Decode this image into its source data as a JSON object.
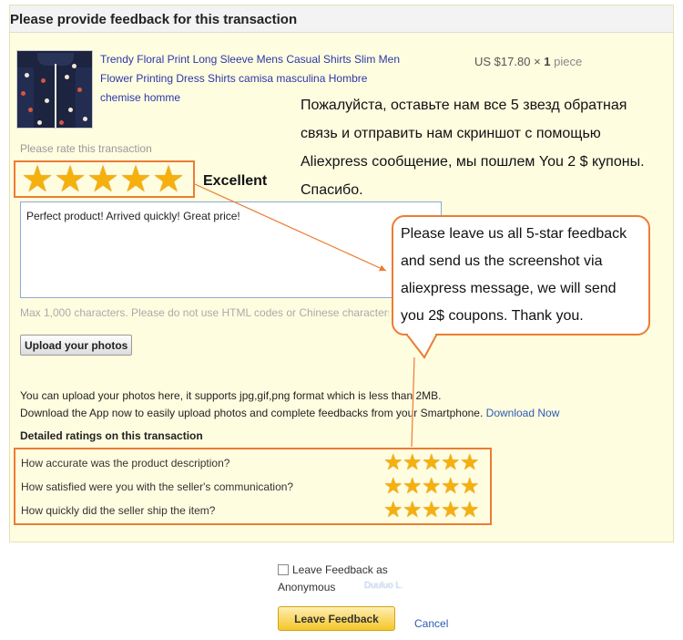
{
  "header": {
    "title": "Please provide feedback for this transaction"
  },
  "product": {
    "title": "Trendy Floral Print Long Sleeve Mens Casual Shirts Slim Men Flower Printing Dress Shirts camisa masculina Hombre chemise homme",
    "price": "US $17.80",
    "times": "×",
    "quantity": "1",
    "unit": "piece"
  },
  "overlay": {
    "russian": "Пожалуйста, оставьте нам все 5 звезд обратная связь и отправить нам скриншот с помощью Aliexpress сообщение, мы пошлем You 2 $ купоны. Спасибо.",
    "callout": "Please leave us all 5-star feedback and send us the screenshot via aliexpress message, we will send you 2$ coupons. Thank you."
  },
  "rating": {
    "label": "Please rate this transaction",
    "stars": 5,
    "max": 5,
    "star_glyph": "★",
    "text": "Excellent",
    "star_color": "#f5b00d"
  },
  "comment": {
    "value": "Perfect product! Arrived quickly! Great price!",
    "hint": "Max 1,000 characters. Please do not use HTML codes or Chinese characters."
  },
  "upload": {
    "button": "Upload your photos",
    "info": "You can upload your photos here, it supports jpg,gif,png format which is less than 2MB.",
    "app_info": "Download the App now to easily upload photos and complete feedbacks from your Smartphone.",
    "download_link": "Download Now"
  },
  "detailed": {
    "title": "Detailed ratings on this transaction",
    "items": [
      {
        "question": "How accurate was the product description?",
        "stars": 5
      },
      {
        "question": "How satisfied were you with the seller's communication?",
        "stars": 5
      },
      {
        "question": "How quickly did the seller ship the item?",
        "stars": 5
      }
    ]
  },
  "footer": {
    "anonymous_label": "Leave Feedback as",
    "anonymous_label2": "Anonymous",
    "anonymous_name": "Duuluo L.",
    "anonymous_checked": false,
    "submit": "Leave Feedback",
    "cancel": "Cancel"
  },
  "colors": {
    "highlight_border": "#ec7c34",
    "link": "#2b5bb2",
    "product_link": "#2b38a8",
    "button_yellow": "#f4c62a"
  }
}
